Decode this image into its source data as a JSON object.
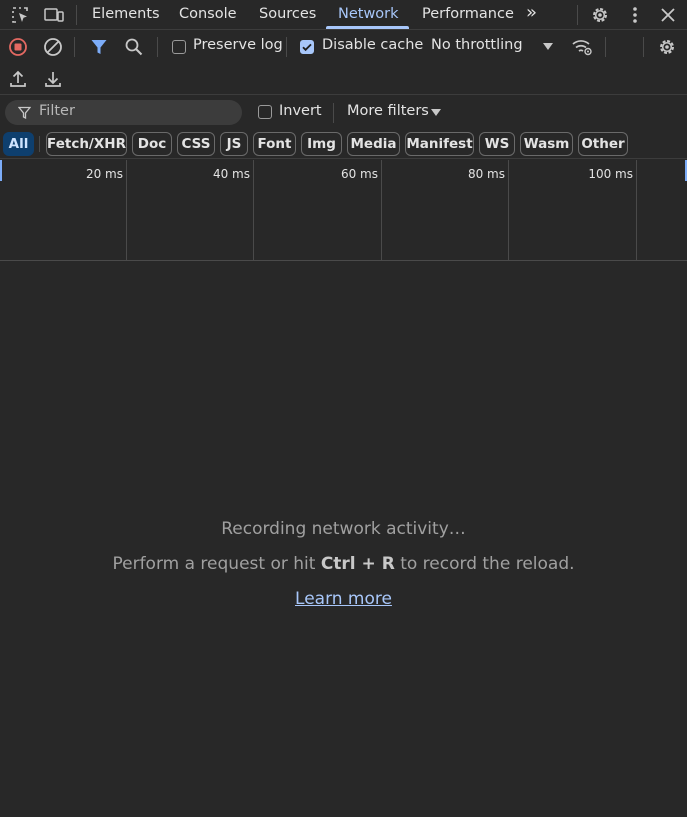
{
  "tabs": {
    "items": [
      "Elements",
      "Console",
      "Sources",
      "Network",
      "Performance"
    ],
    "active": "Network",
    "more_symbol": "»"
  },
  "toolbar": {
    "preserve_log_label": "Preserve log",
    "preserve_log_checked": false,
    "disable_cache_label": "Disable cache",
    "disable_cache_checked": true,
    "throttling_value": "No throttling"
  },
  "filter": {
    "placeholder": "Filter",
    "invert_label": "Invert",
    "more_filters_label": "More filters"
  },
  "type_filters": [
    "All",
    "Fetch/XHR",
    "Doc",
    "CSS",
    "JS",
    "Font",
    "Img",
    "Media",
    "Manifest",
    "WS",
    "Wasm",
    "Other"
  ],
  "type_filters_active": "All",
  "timeline": {
    "ticks": [
      "20 ms",
      "40 ms",
      "60 ms",
      "80 ms",
      "100 ms"
    ]
  },
  "empty_state": {
    "title": "Recording network activity…",
    "hint_prefix": "Perform a request or hit ",
    "hint_shortcut": "Ctrl + R",
    "hint_suffix": " to record the reload.",
    "learn_more": "Learn more"
  },
  "colors": {
    "accent": "#a8c7fa",
    "record": "#e46962",
    "background": "#282828"
  },
  "icons": [
    "inspect-element-icon",
    "device-toolbar-icon",
    "settings-icon",
    "kebab-menu-icon",
    "close-icon",
    "record-icon",
    "clear-icon",
    "filter-funnel-icon",
    "search-icon",
    "network-conditions-icon",
    "import-har-icon",
    "export-har-icon"
  ]
}
